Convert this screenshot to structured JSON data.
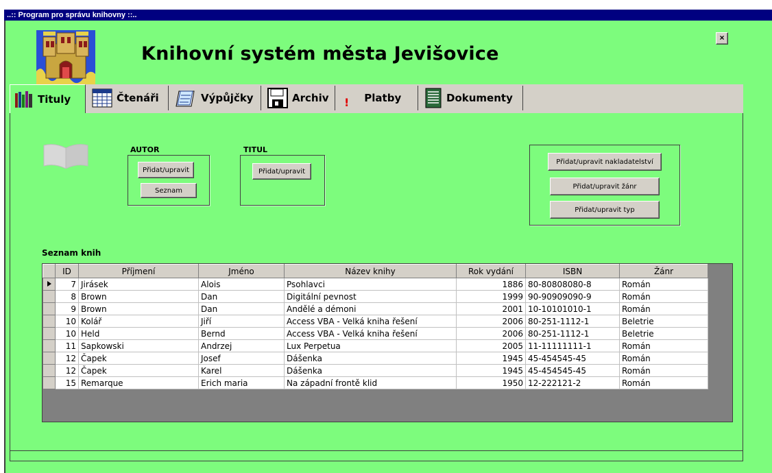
{
  "window": {
    "title": "..:: Program pro správu knihovny ::..",
    "close_label": "×"
  },
  "header": {
    "title": "Knihovní systém města Jevišovice"
  },
  "tabs": [
    {
      "label": "Tituly",
      "icon": "books-icon"
    },
    {
      "label": "Čtenáři",
      "icon": "calendar-icon"
    },
    {
      "label": "Výpůjčky",
      "icon": "notepad-icon"
    },
    {
      "label": "Archiv",
      "icon": "floppy-icon"
    },
    {
      "label": "Platby",
      "icon": "exclamation-icon"
    },
    {
      "label": "Dokumenty",
      "icon": "document-icon"
    }
  ],
  "autor": {
    "label": "AUTOR",
    "add_edit": "Přidat/upravit",
    "list": "Seznam"
  },
  "titul": {
    "label": "TITUL",
    "add_edit": "Přidat/upravit"
  },
  "other_buttons": {
    "publisher": "Přidat/upravit nakladatelství",
    "genre": "Přidat/upravit žánr",
    "type": "Přidat/upravit typ"
  },
  "books": {
    "title": "Seznam knih",
    "columns": [
      "ID",
      "Příjmení",
      "Jméno",
      "Název knihy",
      "Rok vydání",
      "ISBN",
      "Žánr"
    ],
    "rows": [
      [
        "7",
        "Jirásek",
        "Alois",
        "Psohlavci",
        "1886",
        "80-80808080-8",
        "Román"
      ],
      [
        "8",
        "Brown",
        "Dan",
        "Digitální pevnost",
        "1999",
        "90-90909090-9",
        "Román"
      ],
      [
        "9",
        "Brown",
        "Dan",
        "Andělé a démoni",
        "2001",
        "10-10101010-1",
        "Román"
      ],
      [
        "10",
        "Kolář",
        "Jiří",
        "Access VBA - Velká kniha řešení",
        "2006",
        "80-251-1112-1",
        "Beletrie"
      ],
      [
        "10",
        "Held",
        "Bernd",
        "Access VBA - Velká kniha řešení",
        "2006",
        "80-251-1112-1",
        "Beletrie"
      ],
      [
        "11",
        "Sapkowski",
        "Andrzej",
        "Lux Perpetua",
        "2005",
        "11-11111111-1",
        "Román"
      ],
      [
        "12",
        "Čapek",
        "Josef",
        "Dášenka",
        "1945",
        "45-454545-45",
        "Román"
      ],
      [
        "12",
        "Čapek",
        "Karel",
        "Dášenka",
        "1945",
        "45-454545-45",
        "Román"
      ],
      [
        "15",
        "Remarque",
        "Erich maria",
        "Na západní frontě klid",
        "1950",
        "12-222121-2",
        "Román"
      ]
    ]
  }
}
